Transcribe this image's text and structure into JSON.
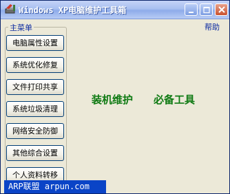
{
  "window": {
    "title": "Windows XP电脑维护工具箱"
  },
  "menu": {
    "caption": "主菜单",
    "help_label": "帮助",
    "items": [
      {
        "label": "电脑属性设置"
      },
      {
        "label": "系统优化修复"
      },
      {
        "label": "文件打印共享"
      },
      {
        "label": "系统垃圾清理"
      },
      {
        "label": "网络安全防御"
      },
      {
        "label": "其他综合设置"
      },
      {
        "label": "个人资料转移"
      }
    ]
  },
  "banner": {
    "left": "装机维护",
    "right": "必备工具"
  },
  "status": {
    "text": "ARP联盟 arpun.com"
  },
  "colors": {
    "title_gradient": "#a9c0f0",
    "banner_green": "#0e7a12",
    "status_blue": "#0a44c7"
  },
  "icons": [
    "app-icon",
    "minimize-icon",
    "maximize-icon",
    "close-icon"
  ]
}
